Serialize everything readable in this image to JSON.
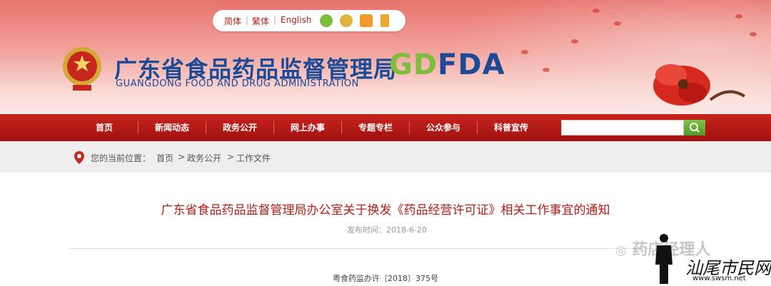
{
  "top_links": {
    "simplified": "简体",
    "traditional": "繁体",
    "english": "English"
  },
  "header": {
    "title": "广东省食品药品监督管理局",
    "subtitle": "GUANGDONG FOOD AND DRUG ADMINISTRATION",
    "logo_gd": "GD",
    "logo_f": "F",
    "logo_da": "DA"
  },
  "nav": {
    "items": [
      "首页",
      "新闻动态",
      "政务公开",
      "网上办事",
      "专题专栏",
      "公众参与",
      "科普宣传"
    ]
  },
  "search": {
    "value": ""
  },
  "breadcrumb": {
    "prefix": "您的当前位置：",
    "items": [
      "首页",
      "政务公开",
      "工作文件"
    ],
    "separator": ">"
  },
  "article": {
    "title": "广东省食品药品监督管理局办公室关于换发《药品经营许可证》相关工作事宜的通知",
    "date_label": "发布时间：",
    "date": "2018-6-20",
    "doc_number": "粤食药监办许〔2018〕375号"
  },
  "watermarks": {
    "wechat": "药店经理人",
    "site_cn": "汕尾市民网",
    "site_url": "www.swsm.net"
  },
  "colors": {
    "nav_red": "#b01a15",
    "title_blue": "#1b4a96",
    "logo_green": "#7cbd3b",
    "article_title_red": "#b01f16"
  }
}
